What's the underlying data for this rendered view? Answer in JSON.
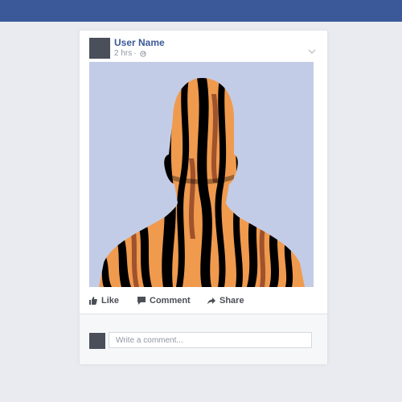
{
  "header": {
    "bar_color": "#3b5998"
  },
  "post": {
    "author": "User Name",
    "time": "2 hrs",
    "separator": "·",
    "privacy_icon": "globe-icon",
    "menu_icon": "chevron-down-icon",
    "photo": {
      "subject": "person-silhouette-tiger-stripes",
      "background_color": "#c3cce6",
      "stripe_colors": [
        "#f09a4e",
        "#000000",
        "#a0522d"
      ]
    }
  },
  "actions": {
    "like_label": "Like",
    "comment_label": "Comment",
    "share_label": "Share"
  },
  "comment_box": {
    "placeholder": "Write a comment..."
  },
  "colors": {
    "link": "#3b5998",
    "action_text": "#4b4f56",
    "meta_text": "#9197a3"
  }
}
